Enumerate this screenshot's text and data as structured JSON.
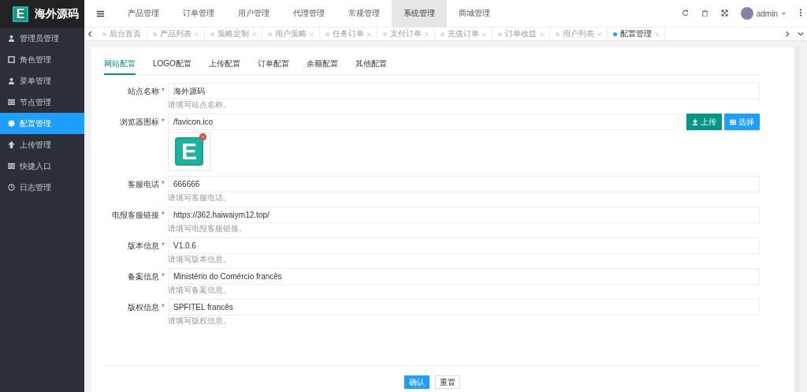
{
  "sidebar": {
    "logo_letter": "E",
    "logo_text": "海外源码",
    "items": [
      {
        "label": "管理员管理",
        "selected": false
      },
      {
        "label": "角色管理",
        "selected": false
      },
      {
        "label": "菜单管理",
        "selected": false
      },
      {
        "label": "节点管理",
        "selected": false
      },
      {
        "label": "配置管理",
        "selected": true
      },
      {
        "label": "上传管理",
        "selected": false
      },
      {
        "label": "快捷入口",
        "selected": false
      },
      {
        "label": "日志管理",
        "selected": false
      }
    ]
  },
  "topnav": {
    "items": [
      {
        "label": "产品管理",
        "selected": false
      },
      {
        "label": "订单管理",
        "selected": false
      },
      {
        "label": "用户管理",
        "selected": false
      },
      {
        "label": "代理管理",
        "selected": false
      },
      {
        "label": "常规管理",
        "selected": false
      },
      {
        "label": "系统管理",
        "selected": true
      },
      {
        "label": "商城管理",
        "selected": false
      }
    ],
    "user": "admin"
  },
  "page_tabs": [
    {
      "label": "后台首页",
      "selected": false,
      "closable": false
    },
    {
      "label": "产品列表",
      "selected": false,
      "closable": true
    },
    {
      "label": "策略定制",
      "selected": false,
      "closable": true
    },
    {
      "label": "用户策略",
      "selected": false,
      "closable": true
    },
    {
      "label": "任务订单",
      "selected": false,
      "closable": true
    },
    {
      "label": "支付订单",
      "selected": false,
      "closable": true
    },
    {
      "label": "充值订单",
      "selected": false,
      "closable": true
    },
    {
      "label": "订单收益",
      "selected": false,
      "closable": true
    },
    {
      "label": "用户列表",
      "selected": false,
      "closable": true
    },
    {
      "label": "配置管理",
      "selected": true,
      "closable": true
    }
  ],
  "config_tabs": [
    {
      "label": "网站配置",
      "selected": true
    },
    {
      "label": "LOGO配置",
      "selected": false
    },
    {
      "label": "上传配置",
      "selected": false
    },
    {
      "label": "订单配置",
      "selected": false
    },
    {
      "label": "余额配置",
      "selected": false
    },
    {
      "label": "其他配置",
      "selected": false
    }
  ],
  "form": {
    "fields": [
      {
        "kind": "text",
        "label": "站点名称",
        "mark": "*",
        "value": "海外源码",
        "help": "请填写站点名称。"
      },
      {
        "kind": "image",
        "label": "浏览器图标",
        "mark": "*",
        "value": "/favicon.ico",
        "buttons": [
          "上传",
          "选择"
        ],
        "preview_letter": "E"
      },
      {
        "kind": "text",
        "label": "客服电话",
        "mark": "*",
        "value": "666666",
        "help": "请填写客服电话。"
      },
      {
        "kind": "text",
        "label": "电报客服链接",
        "mark": "*",
        "value": "https://362.haiwaiym12.top/",
        "help": "请填写电报客服链接。"
      },
      {
        "kind": "text",
        "label": "版本信息",
        "mark": "*",
        "value": "V1.0.6",
        "help": "请填写版本信息。"
      },
      {
        "kind": "text",
        "label": "备案信息",
        "mark": "*",
        "value": "Ministério do Comércio francês",
        "help": "请填写备案信息。"
      },
      {
        "kind": "text",
        "label": "版权信息",
        "mark": "*",
        "value": "SPFITEL francês",
        "help": "请填写版权信息。"
      }
    ],
    "actions": [
      {
        "label": "确认",
        "kind": "primary"
      },
      {
        "label": "重置",
        "kind": "default"
      }
    ]
  }
}
